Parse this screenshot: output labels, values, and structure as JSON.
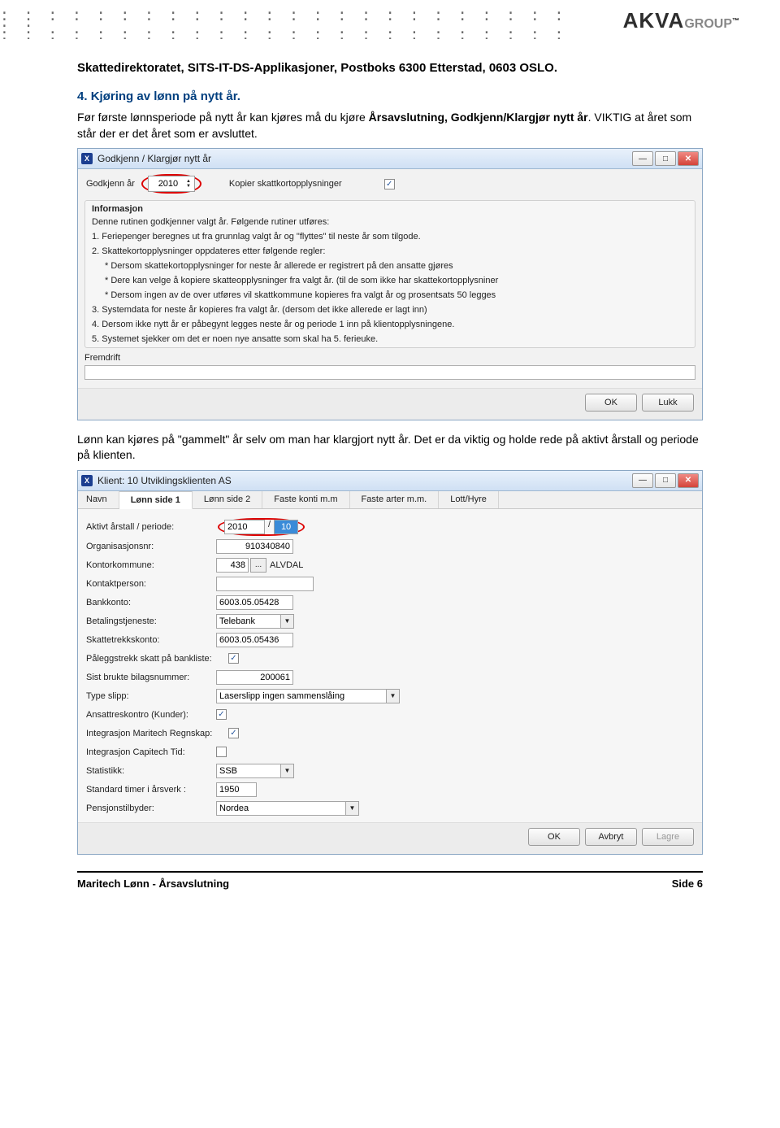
{
  "logo": {
    "main": "AKVA",
    "sub": "GROUP",
    "tm": "™"
  },
  "address": "Skattedirektoratet, SITS-IT-DS-Applikasjoner, Postboks 6300 Etterstad, 0603 OSLO.",
  "section_num": "4.",
  "section_title": "Kjøring av lønn på nytt år.",
  "para1a": "Før første lønnsperiode på nytt år kan kjøres må du kjøre ",
  "para1b": "Årsavslutning, Godkjenn/Klargjør nytt år",
  "para1c": ". VIKTIG at året som står der er det året som er avsluttet.",
  "dlg1": {
    "title": "Godkjenn / Klargjør nytt år",
    "approve_label": "Godkjenn år",
    "year": "2010",
    "copy_label": "Kopier skattkortopplysninger",
    "info_title": "Informasjon",
    "lines": [
      "Denne rutinen godkjenner valgt år. Følgende rutiner utføres:",
      "1. Feriepenger beregnes ut fra grunnlag valgt år og \"flyttes\" til neste år som tilgode.",
      "2. Skattekortopplysninger oppdateres etter følgende regler:",
      "* Dersom skattekortopplysninger for neste år allerede er registrert på den ansatte gjøres",
      "* Dere kan velge å kopiere skatteopplysninger fra valgt år. (til de som ikke har skattekortopplysniner",
      "* Dersom ingen av de over utføres vil skattkommune kopieres fra valgt år og prosentsats 50 legges",
      "3. Systemdata for neste år kopieres fra valgt år. (dersom det ikke allerede er lagt inn)",
      "4. Dersom ikke nytt år er påbegynt legges neste år og periode 1 inn på klientopplysningene.",
      "5. Systemet sjekker om det er noen nye ansatte som skal ha 5. ferieuke."
    ],
    "progress_label": "Fremdrift",
    "ok": "OK",
    "close": "Lukk"
  },
  "para2": "Lønn kan kjøres på \"gammelt\" år selv om man har klargjort nytt år. Det er da viktig og holde rede på aktivt årstall og periode på klienten.",
  "dlg2": {
    "title": "Klient:  10  Utviklingsklienten AS",
    "tabs": [
      "Navn",
      "Lønn side 1",
      "Lønn side 2",
      "Faste konti m.m",
      "Faste arter m.m.",
      "Lott/Hyre"
    ],
    "fields": {
      "active_year_label": "Aktivt årstall / periode:",
      "year": "2010",
      "period": "10",
      "orgnr_label": "Organisasjonsnr:",
      "orgnr": "910340840",
      "kontor_label": "Kontorkommune:",
      "kontor_code": "438",
      "kontor_name": "ALVDAL",
      "kontakt_label": "Kontaktperson:",
      "kontakt": "",
      "bank_label": "Bankkonto:",
      "bank": "6003.05.05428",
      "betaling_label": "Betalingstjeneste:",
      "betaling": "Telebank",
      "skatt_label": "Skattetrekkskonto:",
      "skatt": "6003.05.05436",
      "palegg_label": "Påleggstrekk skatt på bankliste:",
      "bilag_label": "Sist brukte bilagsnummer:",
      "bilag": "200061",
      "slipp_label": "Type slipp:",
      "slipp": "Laserslipp ingen sammenslåing",
      "ansatt_label": "Ansattreskontro (Kunder):",
      "maritech_label": "Integrasjon Maritech Regnskap:",
      "capitech_label": "Integrasjon Capitech Tid:",
      "stat_label": "Statistikk:",
      "stat": "SSB",
      "timer_label": "Standard timer i årsverk :",
      "timer": "1950",
      "pensjon_label": "Pensjonstilbyder:",
      "pensjon": "Nordea"
    },
    "ok": "OK",
    "cancel": "Avbryt",
    "save": "Lagre"
  },
  "footer": {
    "left": "Maritech Lønn - Årsavslutning",
    "right": "Side 6"
  }
}
